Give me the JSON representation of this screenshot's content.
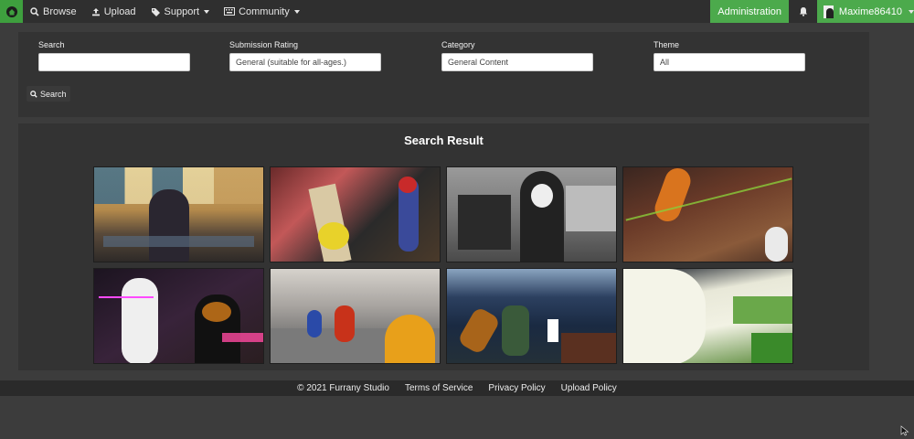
{
  "nav": {
    "browse": "Browse",
    "upload": "Upload",
    "support": "Support",
    "community": "Community",
    "administration": "Administration",
    "username": "Maxime86410"
  },
  "search": {
    "fields": [
      {
        "label": "Search",
        "value": ""
      },
      {
        "label": "Submission Rating",
        "value": "General (suitable for all-ages.)"
      },
      {
        "label": "Category",
        "value": "General Content"
      },
      {
        "label": "Theme",
        "value": "All"
      }
    ],
    "button": "Search"
  },
  "results": {
    "title": "Search Result"
  },
  "footer": {
    "copyright": "© 2021 Furrany Studio",
    "terms": "Terms of Service",
    "privacy": "Privacy Policy",
    "upload_policy": "Upload Policy"
  },
  "colors": {
    "accent_green": "#4caa4c",
    "navbar": "#2f2f2f",
    "panel": "#333333",
    "background": "#3c3c3c"
  }
}
